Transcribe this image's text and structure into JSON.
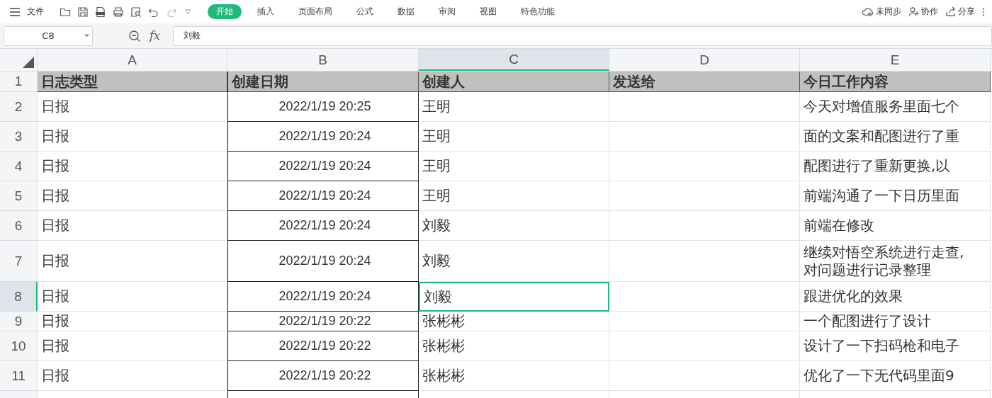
{
  "menu": {
    "label": "文件"
  },
  "tabs": [
    {
      "label": "开始",
      "selected": true
    },
    {
      "label": "插入",
      "selected": false
    },
    {
      "label": "页面布局",
      "selected": false
    },
    {
      "label": "公式",
      "selected": false
    },
    {
      "label": "数据",
      "selected": false
    },
    {
      "label": "审阅",
      "selected": false
    },
    {
      "label": "视图",
      "selected": false
    },
    {
      "label": "特色功能",
      "selected": false
    }
  ],
  "right_actions": [
    {
      "label": "未同步",
      "kind": "sync"
    },
    {
      "label": "协作",
      "kind": "collab"
    },
    {
      "label": "分享",
      "kind": "share"
    }
  ],
  "name_box": "C8",
  "function_label": "fx",
  "formula": "刘毅",
  "columns": [
    {
      "label": "A",
      "selected": false
    },
    {
      "label": "B",
      "selected": false
    },
    {
      "label": "C",
      "selected": true
    },
    {
      "label": "D",
      "selected": false
    },
    {
      "label": "E",
      "selected": false
    }
  ],
  "rows": [
    {
      "number": "1",
      "kind": "header",
      "selected": false,
      "cells": [
        "日志类型",
        "创建日期",
        "创建人",
        "发送给",
        "今日工作内容"
      ]
    },
    {
      "number": "2",
      "kind": "data",
      "selected": false,
      "cells": [
        "日报",
        "2022/1/19 20:25",
        "王明",
        null,
        "今天对增值服务里面七个"
      ]
    },
    {
      "number": "3",
      "kind": "data",
      "selected": false,
      "cells": [
        "日报",
        "2022/1/19 20:24",
        "王明",
        null,
        "面的文案和配图进行了重"
      ]
    },
    {
      "number": "4",
      "kind": "data",
      "selected": false,
      "cells": [
        "日报",
        "2022/1/19 20:24",
        "王明",
        null,
        "配图进行了重新更换,以"
      ]
    },
    {
      "number": "5",
      "kind": "data",
      "selected": false,
      "cells": [
        "日报",
        "2022/1/19 20:24",
        "王明",
        null,
        "前端沟通了一下日历里面"
      ]
    },
    {
      "number": "6",
      "kind": "data",
      "selected": false,
      "cells": [
        "日报",
        "2022/1/19 20:24",
        "刘毅",
        null,
        "前端在修改"
      ]
    },
    {
      "number": "7",
      "kind": "data",
      "selected": false,
      "cells": [
        "日报",
        "2022/1/19 20:24",
        "刘毅",
        null,
        "继续对悟空系统进行走查,\n对问题进行记录整理"
      ]
    },
    {
      "number": "8",
      "kind": "data",
      "selected": true,
      "cells": [
        "日报",
        "2022/1/19 20:24",
        "刘毅",
        null,
        "跟进优化的效果"
      ]
    },
    {
      "number": "9",
      "kind": "data",
      "selected": false,
      "cells": [
        "日报",
        "2022/1/19 20:22",
        "张彬彬",
        null,
        "一个配图进行了设计"
      ]
    },
    {
      "number": "10",
      "kind": "data",
      "selected": false,
      "cells": [
        "日报",
        "2022/1/19 20:22",
        "张彬彬",
        null,
        "设计了一下扫码枪和电子"
      ]
    },
    {
      "number": "11",
      "kind": "data",
      "selected": false,
      "cells": [
        "日报",
        "2022/1/19 20:22",
        "张彬彬",
        null,
        "优化了一下无代码里面9"
      ]
    }
  ]
}
